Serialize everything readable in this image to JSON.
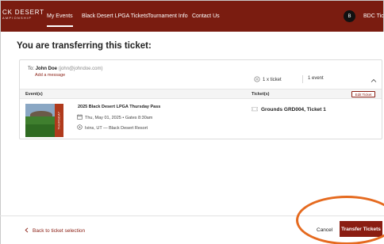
{
  "nav": {
    "brand_top": "CK DESERT",
    "brand_bottom": "AMPIONSHIP",
    "links": [
      "My Events",
      "Black Desert LPGA Tickets",
      "Tournament Info",
      "Contact Us"
    ],
    "active_link": "My Events",
    "avatar_initial": "B",
    "account_label": "BDC Tic"
  },
  "page": {
    "title": "You are transferring this ticket:"
  },
  "recipient": {
    "to_label": "To:",
    "name": "John Doe",
    "email": "(john@johndoe.com)",
    "add_message": "Add a message"
  },
  "summary": {
    "tickets": "1 x ticket",
    "events": "1 event"
  },
  "table": {
    "events_header": "Event(s)",
    "tickets_header": "Ticket(s)",
    "edit_label": "Edit Ticket"
  },
  "event": {
    "name": "2025 Black Desert LPGA Thursday Pass",
    "date": "Thu, May 01, 2025 • Gates 8:30am",
    "location": "Ivins, UT — Black Desert Resort",
    "badge": "THURSDAY",
    "ticket": "Grounds GRD004, Ticket 1"
  },
  "footer": {
    "back_label": "Back to ticket selection",
    "cancel_label": "Cancel",
    "transfer_label": "Transfer Tickets"
  },
  "colors": {
    "nav_bg": "#7a1c10",
    "accent": "#8a1d12",
    "highlight": "#e56a1f"
  },
  "icons": [
    "ticket-icon",
    "chevron-up-icon",
    "calendar-icon",
    "location-pin-icon",
    "chevron-left-icon"
  ]
}
